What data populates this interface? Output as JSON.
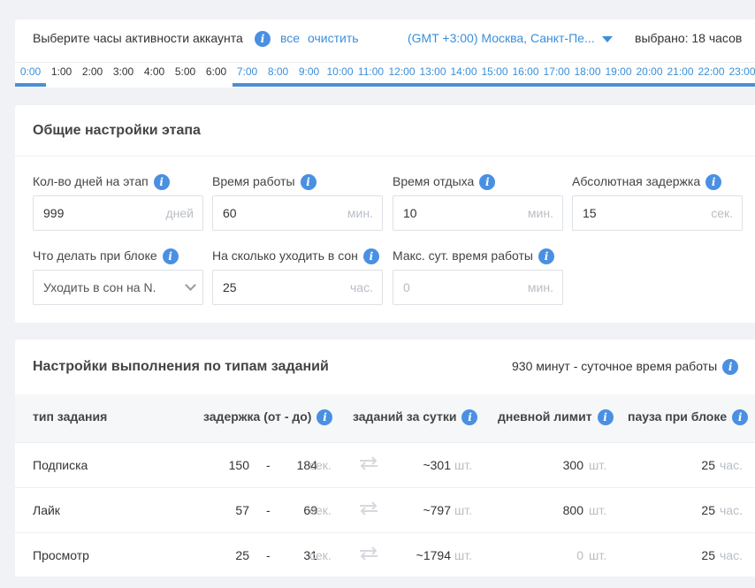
{
  "hours_panel": {
    "prompt": "Выберите часы активности аккаунта",
    "all_link": "все",
    "clear_link": "очистить",
    "timezone": "(GMT +3:00) Москва, Санкт-Пе...",
    "selected": "выбрано: 18 часов",
    "hours": [
      "0:00",
      "1:00",
      "2:00",
      "3:00",
      "4:00",
      "5:00",
      "6:00",
      "7:00",
      "8:00",
      "9:00",
      "10:00",
      "11:00",
      "12:00",
      "13:00",
      "14:00",
      "15:00",
      "16:00",
      "17:00",
      "18:00",
      "19:00",
      "20:00",
      "21:00",
      "22:00",
      "23:00"
    ],
    "selected_hours": [
      "0:00",
      "7:00",
      "8:00",
      "9:00",
      "10:00",
      "11:00",
      "12:00",
      "13:00",
      "14:00",
      "15:00",
      "16:00",
      "17:00",
      "18:00",
      "19:00",
      "20:00",
      "21:00",
      "22:00",
      "23:00"
    ]
  },
  "stage": {
    "title": "Общие настройки этапа",
    "fields": [
      {
        "label": "Кол-во дней на этап",
        "value": "999",
        "unit": "дней"
      },
      {
        "label": "Время работы",
        "value": "60",
        "unit": "мин."
      },
      {
        "label": "Время отдыха",
        "value": "10",
        "unit": "мин."
      },
      {
        "label": "Абсолютная задержка",
        "value": "15",
        "unit": "сек."
      },
      {
        "label": "Что делать при блоке",
        "value": "Уходить в сон на N."
      },
      {
        "label": "На сколько уходить в сон",
        "value": "25",
        "unit": "час."
      },
      {
        "label": "Макс. сут. время работы",
        "placeholder": "0",
        "unit": "мин."
      }
    ]
  },
  "tasks": {
    "title": "Настройки выполнения по типам заданий",
    "daily_work_time": "930 минут - суточное время работы",
    "columns": [
      "тип задания",
      "задержка (от - до)",
      "заданий за сутки",
      "дневной лимит",
      "пауза при блоке"
    ],
    "rows": [
      {
        "type": "Подписка",
        "from": "150",
        "dash": "-",
        "to": "184",
        "delay_unit": "сек.",
        "per_day": "~301",
        "per_day_unit": "шт.",
        "limit": "300",
        "limit_unit": "шт.",
        "pause": "25",
        "pause_unit": "час."
      },
      {
        "type": "Лайк",
        "from": "57",
        "dash": "-",
        "to": "69",
        "delay_unit": "сек.",
        "per_day": "~797",
        "per_day_unit": "шт.",
        "limit": "800",
        "limit_unit": "шт.",
        "pause": "25",
        "pause_unit": "час."
      },
      {
        "type": "Просмотр",
        "from": "25",
        "dash": "-",
        "to": "31",
        "delay_unit": "сек.",
        "per_day": "~1794",
        "per_day_unit": "шт.",
        "limit": "0",
        "limit_unit": "шт.",
        "pause": "25",
        "pause_unit": "час."
      }
    ]
  },
  "icons": {
    "info": "i",
    "swap": "swap-arrows-icon",
    "dropdown": "chevron-down-icon"
  },
  "colors": {
    "accent": "#4a8fd4",
    "link": "#3b8fd9",
    "info_icon": "#4a90e2"
  }
}
